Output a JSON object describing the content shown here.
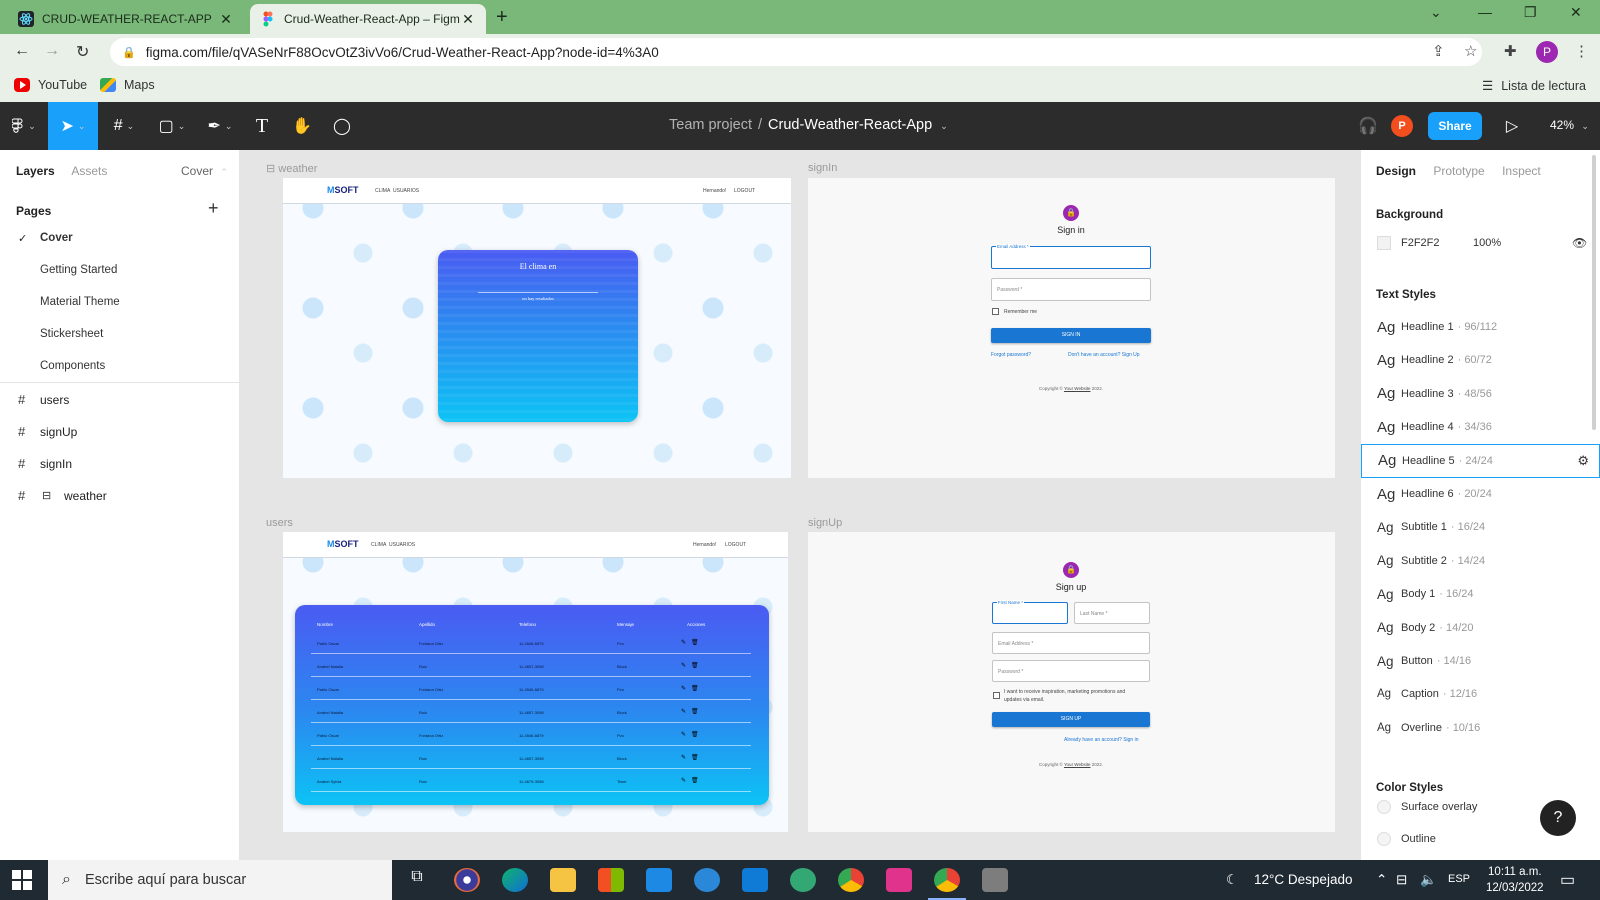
{
  "browser": {
    "tabs": [
      {
        "title": "CRUD-WEATHER-REACT-APP"
      },
      {
        "title": "Crud-Weather-React-App – Figma"
      }
    ],
    "url": "figma.com/file/qVASeNrF88OcvOtZ3ivVo6/Crud-Weather-React-App?node-id=4%3A0",
    "bookmarks": [
      "YouTube",
      "Maps"
    ],
    "reading_list": "Lista de lectura",
    "profile_initial": "P"
  },
  "figma": {
    "team": "Team project",
    "file": "Crud-Weather-React-App",
    "share": "Share",
    "zoom": "42%",
    "user_initial": "P"
  },
  "left_panel": {
    "tabs": [
      "Layers",
      "Assets"
    ],
    "current_page": "Cover",
    "pages_title": "Pages",
    "pages": [
      "Cover",
      "Getting Started",
      "Material Theme",
      "Stickersheet",
      "Components"
    ],
    "frames": [
      "users",
      "signUp",
      "signIn",
      "weather"
    ]
  },
  "canvas": {
    "labels": {
      "weather": "weather",
      "signin": "signIn",
      "users": "users",
      "signup": "signUp"
    },
    "nav": {
      "brand": "SOFT",
      "link1": "CLIMA",
      "link2": "USUARIOS",
      "user": "Hernando!",
      "logout": "LOGOUT"
    },
    "weather_card": {
      "title": "El clima en",
      "subtitle": "no hay resultados"
    },
    "users_table": {
      "headers": [
        "Nombre",
        "Apellido",
        "Telefono",
        "Mensaje",
        "Acciones"
      ],
      "rows": [
        [
          "Pablo Oscar",
          "Fontana Ortiz",
          "11-4546-6879",
          "Pvo"
        ],
        [
          "Anabel Natalia",
          "Ruiz",
          "11-4657-3098",
          "Block"
        ],
        [
          "Pablo Oscar",
          "Fontana Ortiz",
          "11-4546-6879",
          "Pvo"
        ],
        [
          "Anabel Natalia",
          "Ruiz",
          "11-4657-3098",
          "Block"
        ],
        [
          "Pablo Oscar",
          "Fontana Ortiz",
          "11-4546-6879",
          "Pvo"
        ],
        [
          "Anabel Natalia",
          "Ruiz",
          "11-4657-3098",
          "Block"
        ],
        [
          "Anabel Sylvia",
          "Ruiz",
          "11-4679-3098",
          "Tiwer"
        ]
      ]
    },
    "signin": {
      "title": "Sign in",
      "email": "Email Address *",
      "password": "Password *",
      "remember": "Remember me",
      "button": "SIGN IN",
      "forgot": "Forgot password?",
      "signup_link": "Don't have an account? Sign Up",
      "copyright": "Copyright ©",
      "website": "Your Website",
      "year": "2022."
    },
    "signup": {
      "title": "Sign up",
      "first": "First Name *",
      "last": "Last Name *",
      "email": "Email Address *",
      "password": "Password *",
      "promo": "I want to receive inspiration, marketing promotions and updates via email.",
      "button": "SIGN UP",
      "signin_link": "Already have an account? Sign in",
      "copyright": "Copyright ©",
      "website": "Your Website",
      "year": "2022."
    }
  },
  "right_panel": {
    "tabs": [
      "Design",
      "Prototype",
      "Inspect"
    ],
    "background_title": "Background",
    "background_color": "F2F2F2",
    "background_opacity": "100%",
    "text_styles_title": "Text Styles",
    "text_styles": [
      {
        "name": "Headline 1",
        "size": "· 96/112"
      },
      {
        "name": "Headline 2",
        "size": "· 60/72"
      },
      {
        "name": "Headline 3",
        "size": "· 48/56"
      },
      {
        "name": "Headline 4",
        "size": "· 34/36"
      },
      {
        "name": "Headline 5",
        "size": "· 24/24"
      },
      {
        "name": "Headline 6",
        "size": "· 20/24"
      },
      {
        "name": "Subtitle 1",
        "size": "· 16/24"
      },
      {
        "name": "Subtitle 2",
        "size": "· 14/24"
      },
      {
        "name": "Body 1",
        "size": "· 16/24"
      },
      {
        "name": "Body 2",
        "size": "· 14/20"
      },
      {
        "name": "Button",
        "size": "· 14/16"
      },
      {
        "name": "Caption",
        "size": "· 12/16"
      },
      {
        "name": "Overline",
        "size": "· 10/16"
      }
    ],
    "ag": "Ag",
    "color_styles_title": "Color Styles",
    "color_styles": [
      "Surface overlay",
      "Outline"
    ]
  },
  "taskbar": {
    "search_placeholder": "Escribe aquí para buscar",
    "weather": "12°C  Despejado",
    "lang": "ESP",
    "time": "10:11 a.m.",
    "date": "12/03/2022"
  },
  "colors": {
    "figma_blue": "#18a0fb",
    "chrome_green": "#7ab87a",
    "primary": "#1976d2"
  }
}
